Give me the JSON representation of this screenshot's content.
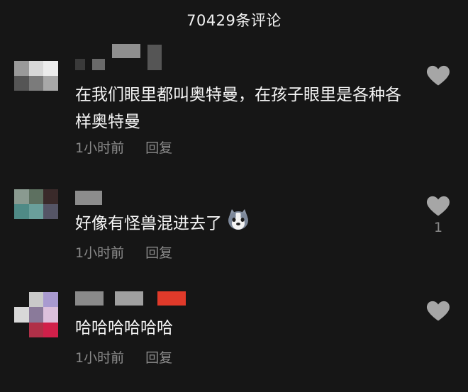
{
  "header": {
    "title": "70429条评论"
  },
  "comments": [
    {
      "text": "在我们眼里都叫奥特曼，在孩子眼里是各种各样奥特曼",
      "time": "1小时前",
      "reply": "回复",
      "likes": ""
    },
    {
      "text": "好像有怪兽混进去了",
      "emoji": "husky-emoji",
      "time": "1小时前",
      "reply": "回复",
      "likes": "1"
    },
    {
      "text": "哈哈哈哈哈哈",
      "time": "1小时前",
      "reply": "回复",
      "likes": ""
    }
  ],
  "icons": {
    "like": "heart-icon"
  },
  "colors": {
    "background": "#161616",
    "text": "#f5f5f5",
    "meta": "#8a8a8a",
    "heart": "#a6a6a6"
  }
}
